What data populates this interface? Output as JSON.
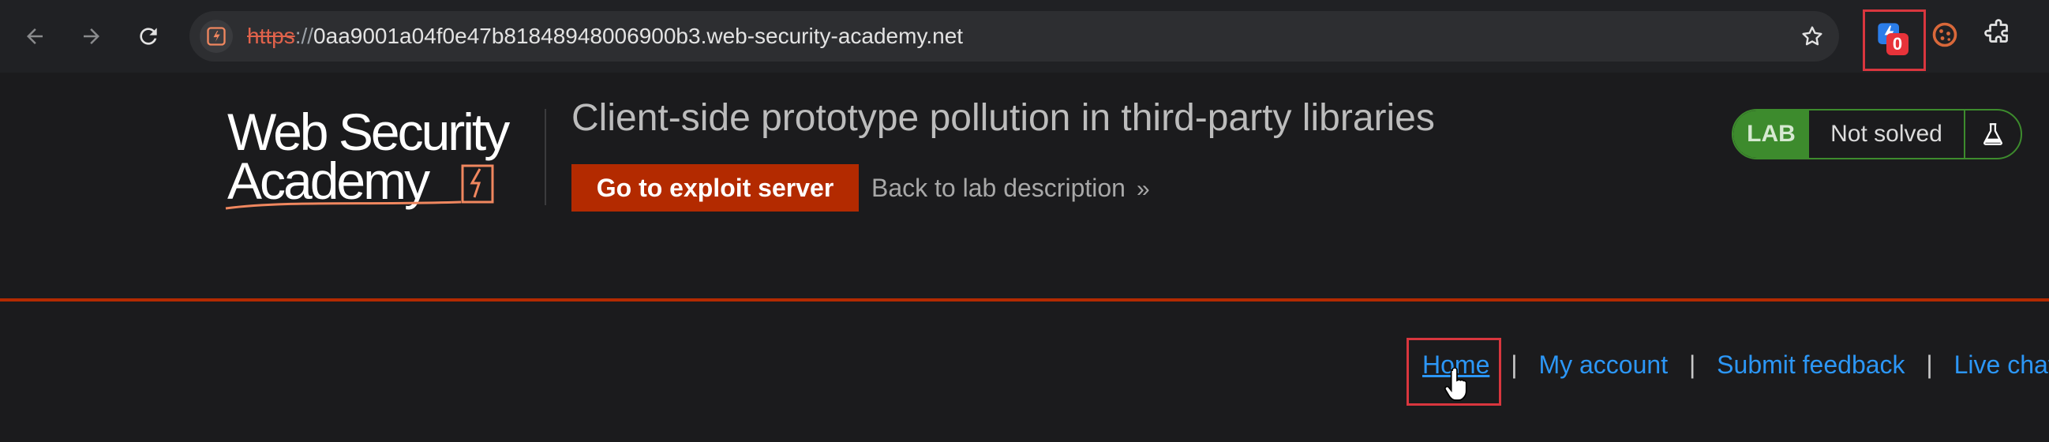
{
  "browser": {
    "url_protocol": "https",
    "url_separator": "://",
    "url_host": "0aa9001a04f0e47b81848948006900b3.web-security-academy.net",
    "extension_badge_count": "0"
  },
  "lab": {
    "logo_line1": "Web Security",
    "logo_line2": "Academy",
    "title": "Client-side prototype pollution in third-party libraries",
    "exploit_button": "Go to exploit server",
    "back_link": "Back to lab description",
    "status_tag": "LAB",
    "status_text": "Not solved"
  },
  "nav": {
    "home": "Home",
    "my_account": "My account",
    "submit_feedback": "Submit feedback",
    "live_chat": "Live chat",
    "separator": "|"
  },
  "colors": {
    "accent_orange": "#b32a00",
    "link_blue": "#2c97f7",
    "status_green": "#3d8b2d",
    "highlight_red": "#d9363e"
  }
}
